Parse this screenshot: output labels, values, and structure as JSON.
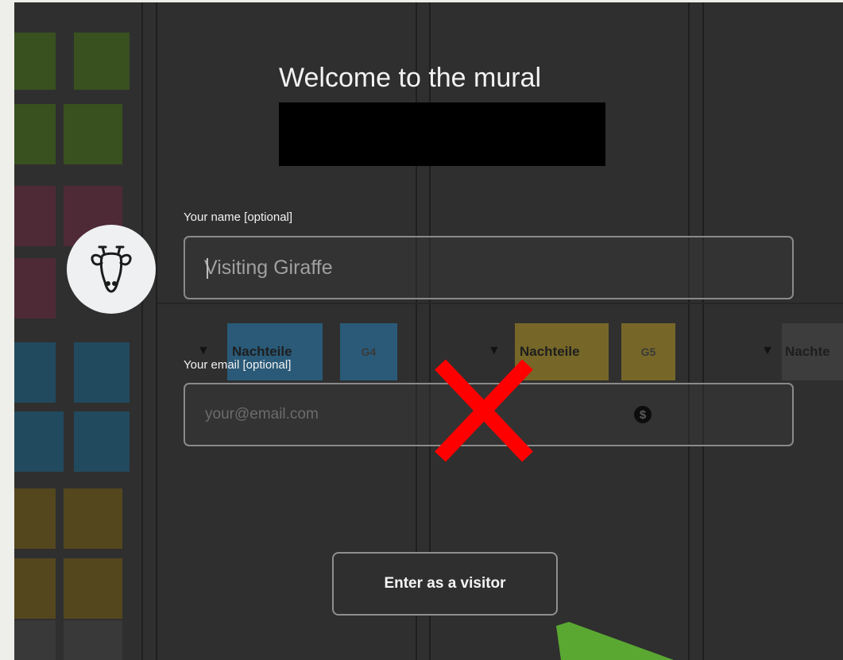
{
  "dialog": {
    "title": "Welcome to the mural",
    "name_label": "Your name [optional]",
    "name_placeholder": "Visiting Giraffe",
    "email_label": "Your email [optional]",
    "email_placeholder": "your@email.com",
    "enter_button": "Enter as a visitor",
    "avatar_icon": "giraffe-icon"
  },
  "board": {
    "columns": [
      {
        "label": "Nachteile",
        "tag": "G4",
        "color": "#2a5a78"
      },
      {
        "label": "Nachteile",
        "tag": "G5",
        "color": "#766728"
      },
      {
        "label": "Nachte",
        "tag": "",
        "color": "#3d3d3d"
      }
    ],
    "sticky_colors": [
      "#38511f",
      "#4e2a36",
      "#224a5e",
      "#54471e",
      "#393939"
    ]
  },
  "annotations": {
    "cross_color": "#ff0000",
    "arrow_color": "#5aa832"
  },
  "icons": {
    "thumbs_down": "thumbs-down-icon",
    "dollar": "dollar-icon"
  }
}
